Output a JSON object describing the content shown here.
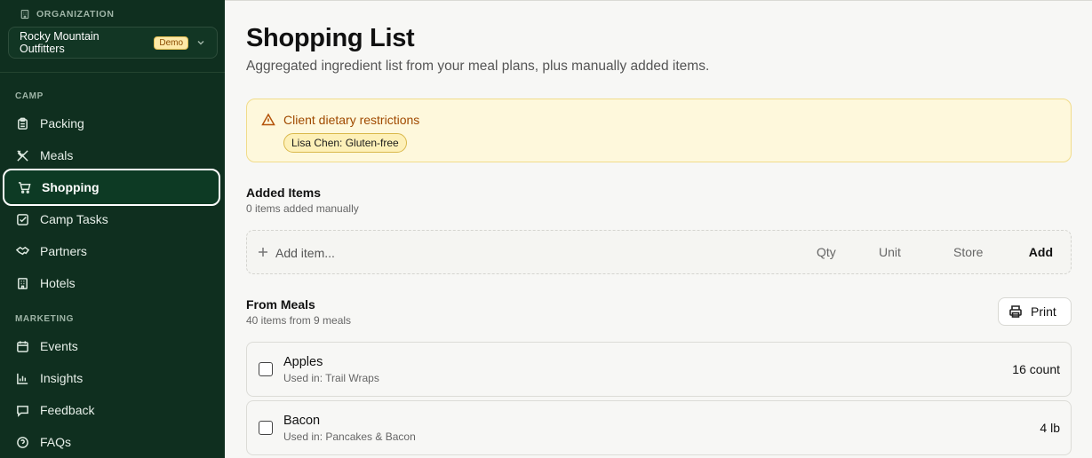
{
  "sidebar": {
    "org_label": "ORGANIZATION",
    "org_name": "Rocky Mountain Outfitters",
    "org_badge": "Demo",
    "camp_label": "CAMP",
    "marketing_label": "MARKETING",
    "camp_items": [
      {
        "label": "Packing",
        "icon": "clipboard-icon"
      },
      {
        "label": "Meals",
        "icon": "utensils-icon"
      },
      {
        "label": "Shopping",
        "icon": "cart-icon",
        "active": true
      },
      {
        "label": "Camp Tasks",
        "icon": "checkbox-icon"
      },
      {
        "label": "Partners",
        "icon": "handshake-icon"
      },
      {
        "label": "Hotels",
        "icon": "building-icon"
      }
    ],
    "marketing_items": [
      {
        "label": "Events",
        "icon": "calendar-icon"
      },
      {
        "label": "Insights",
        "icon": "bar-chart-icon"
      },
      {
        "label": "Feedback",
        "icon": "message-icon"
      },
      {
        "label": "FAQs",
        "icon": "help-circle-icon"
      }
    ]
  },
  "page": {
    "title": "Shopping List",
    "subtitle": "Aggregated ingredient list from your meal plans, plus manually added items."
  },
  "alert": {
    "title": "Client dietary restrictions",
    "chip": "Lisa Chen: Gluten-free",
    "color": "#a04a00"
  },
  "added": {
    "heading": "Added Items",
    "sub": "0 items added manually",
    "placeholder": "Add item...",
    "qty_placeholder": "Qty",
    "unit_placeholder": "Unit",
    "store_placeholder": "Store",
    "add_label": "Add"
  },
  "from_meals": {
    "heading": "From Meals",
    "sub": "40 items from 9 meals",
    "print_label": "Print",
    "items": [
      {
        "name": "Apples",
        "used_in": "Used in: Trail Wraps",
        "qty": "16 count"
      },
      {
        "name": "Bacon",
        "used_in": "Used in: Pancakes & Bacon",
        "qty": "4 lb"
      }
    ]
  },
  "colors": {
    "sidebar_bg": "#0f2f1f",
    "alert_bg": "#fef8dc"
  }
}
